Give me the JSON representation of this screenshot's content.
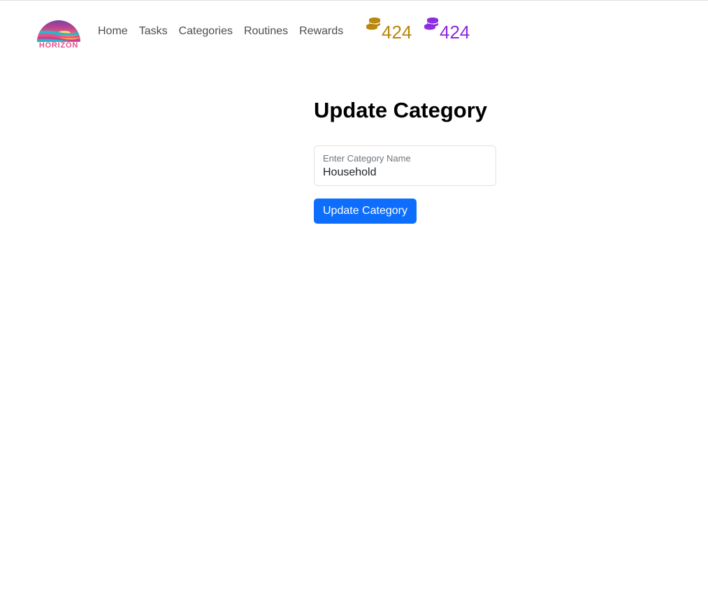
{
  "brand": {
    "logo_text": "HORIZON",
    "colors": {
      "sky_top": "#5b3fa8",
      "sky_mid": "#e8508a",
      "sun": "#ffb347",
      "water": "#2bb5c8",
      "text": "#e8508a"
    }
  },
  "nav": {
    "links": [
      "Home",
      "Tasks",
      "Categories",
      "Routines",
      "Rewards"
    ],
    "link_color": "#4d4d4d"
  },
  "balances": [
    {
      "icon": "coins-icon",
      "value": "424",
      "color": "#b8860b"
    },
    {
      "icon": "coins-icon",
      "value": "424",
      "color": "#8a2be2"
    }
  ],
  "form": {
    "title": "Update Category",
    "name_field": {
      "label": "Enter Category Name",
      "value": "Household",
      "placeholder": "Enter Category Name"
    },
    "submit_label": "Update Category",
    "accent": "#0d6efd"
  }
}
